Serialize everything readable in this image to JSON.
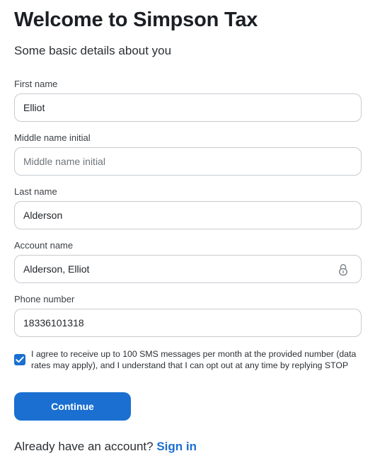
{
  "header": {
    "title": "Welcome to Simpson Tax",
    "subtitle": "Some basic details about you"
  },
  "form": {
    "first_name": {
      "label": "First name",
      "value": "Elliot",
      "placeholder": ""
    },
    "middle_initial": {
      "label": "Middle name initial",
      "value": "",
      "placeholder": "Middle name initial"
    },
    "last_name": {
      "label": "Last name",
      "value": "Alderson",
      "placeholder": ""
    },
    "account_name": {
      "label": "Account name",
      "value": "Alderson, Elliot",
      "placeholder": "",
      "icon": "lock-icon"
    },
    "phone": {
      "label": "Phone number",
      "value": "18336101318",
      "placeholder": ""
    },
    "consent": {
      "checked": true,
      "text": "I agree to receive up to 100 SMS messages per month at the provided number (data rates may apply), and I understand that I can opt out at any time by replying STOP"
    },
    "continue_label": "Continue"
  },
  "footer": {
    "prompt": "Already have an account?",
    "signin_label": "Sign in"
  },
  "colors": {
    "accent": "#1a6fd0",
    "border": "#c7cbd0"
  }
}
